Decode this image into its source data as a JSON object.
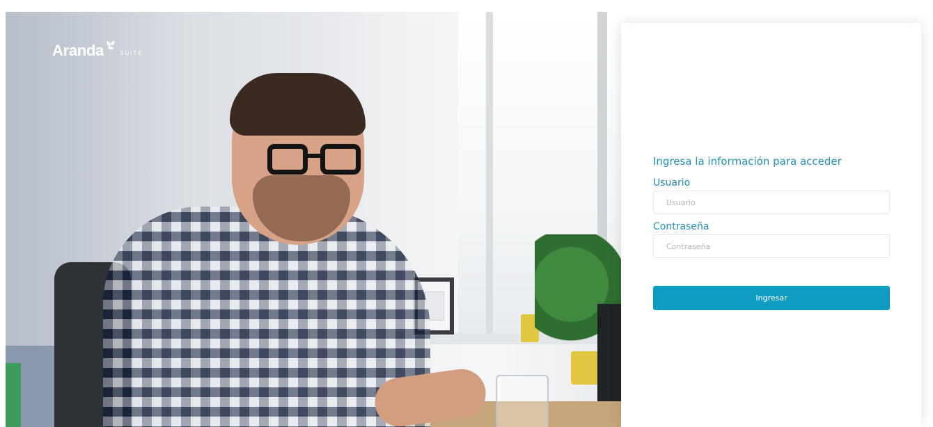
{
  "brand": {
    "name": "Aranda",
    "suite": "SUITE",
    "mark_icon": "leaf-logo-icon"
  },
  "login": {
    "prompt": "Ingresa la información para acceder",
    "username_label": "Usuario",
    "username_placeholder": "Usuario",
    "username_value": "",
    "password_label": "Contraseña",
    "password_placeholder": "Contraseña",
    "password_value": "",
    "submit_label": "Ingresar"
  },
  "colors": {
    "accent": "#1f8fb7",
    "button": "#0f9cc1"
  }
}
